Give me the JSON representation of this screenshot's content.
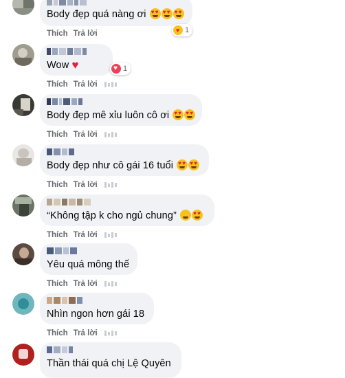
{
  "actions": {
    "like": "Thích",
    "reply": "Trả lời"
  },
  "comments": [
    {
      "text": "Body đẹp quá nàng ơi",
      "emoji": [
        "heart-eyes-emoji",
        "heart-eyes-emoji",
        "heart-eyes-emoji"
      ],
      "reaction": {
        "icon": "care-icon",
        "count": "1"
      }
    },
    {
      "text": "Wow",
      "emoji": [
        "red-heart-emoji"
      ],
      "reaction": {
        "icon": "love-icon",
        "count": "1"
      }
    },
    {
      "text": "Body đẹp mê xỉu luôn cô ơi",
      "emoji": [
        "heart-eyes-emoji",
        "heart-eyes-emoji"
      ]
    },
    {
      "text": "Body đẹp như cô gái 16 tuổi",
      "emoji": [
        "heart-eyes-emoji",
        "smiling-face-with-hearts-emoji"
      ]
    },
    {
      "text": "“Không tập k cho ngủ chung”",
      "emoji": [
        "tears-of-joy-emoji",
        "heart-eyes-emoji"
      ]
    },
    {
      "text": "Yêu quá mông thế",
      "emoji": []
    },
    {
      "text": "Nhìn ngon hơn gái 18",
      "emoji": []
    },
    {
      "text": "Thần thái quá chị Lệ Quyên",
      "emoji": []
    }
  ],
  "colors": {
    "bubble": "#f0f2f5",
    "action_text": "#65676b",
    "love": "#f33e58",
    "emoji_yellow": "#f7c21d"
  }
}
